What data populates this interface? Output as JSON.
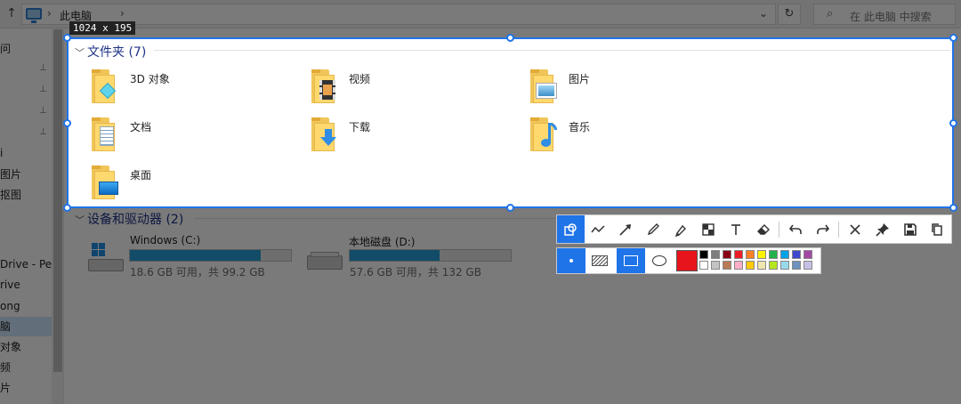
{
  "explorer": {
    "breadcrumb": "此电脑",
    "search_placeholder": "在 此电脑 中搜索"
  },
  "sidebar": {
    "items": [
      "问",
      "",
      "",
      "",
      "",
      "i",
      "图片",
      "抠图",
      "",
      "Drive - Per",
      "rive",
      "ong",
      "脑",
      "对象",
      "频",
      "片"
    ]
  },
  "folders_group": {
    "header": "文件夹 (7)",
    "items": [
      {
        "label": "3D 对象",
        "icon": "3d-objects-icon"
      },
      {
        "label": "视频",
        "icon": "video-icon"
      },
      {
        "label": "图片",
        "icon": "pictures-icon"
      },
      {
        "label": "文档",
        "icon": "documents-icon"
      },
      {
        "label": "下载",
        "icon": "downloads-icon"
      },
      {
        "label": "音乐",
        "icon": "music-icon"
      },
      {
        "label": "桌面",
        "icon": "desktop-icon"
      }
    ]
  },
  "drives_group": {
    "header": "设备和驱动器 (2)",
    "items": [
      {
        "name": "Windows (C:)",
        "free_text": "18.6 GB 可用，共 99.2 GB",
        "used_fraction": 0.81
      },
      {
        "name": "本地磁盘 (D:)",
        "free_text": "57.6 GB 可用，共 132 GB",
        "used_fraction": 0.56
      }
    ]
  },
  "capture": {
    "size_label": "1024 x 195",
    "accent_color": "#1f74e8"
  },
  "toolbar": {
    "row1_tools": [
      "shape-icon",
      "polyline-icon",
      "arrow-icon",
      "pencil-icon",
      "marker-icon",
      "mosaic-icon",
      "text-icon",
      "eraser-icon",
      "undo-icon",
      "redo-icon",
      "close-icon",
      "pin-icon",
      "save-icon",
      "copy-icon"
    ],
    "current_color": "#e8141c",
    "palette": [
      "#000000",
      "#7f7f7f",
      "#880015",
      "#ed1c24",
      "#ff7f27",
      "#fff200",
      "#22b14c",
      "#00a2e8",
      "#3f48cc",
      "#a349a4",
      "#ffffff",
      "#c3c3c3",
      "#b97a57",
      "#ffaec9",
      "#ffc90e",
      "#efe4b0",
      "#b5e61d",
      "#99d9ea",
      "#7092be",
      "#c8bfe7"
    ]
  }
}
